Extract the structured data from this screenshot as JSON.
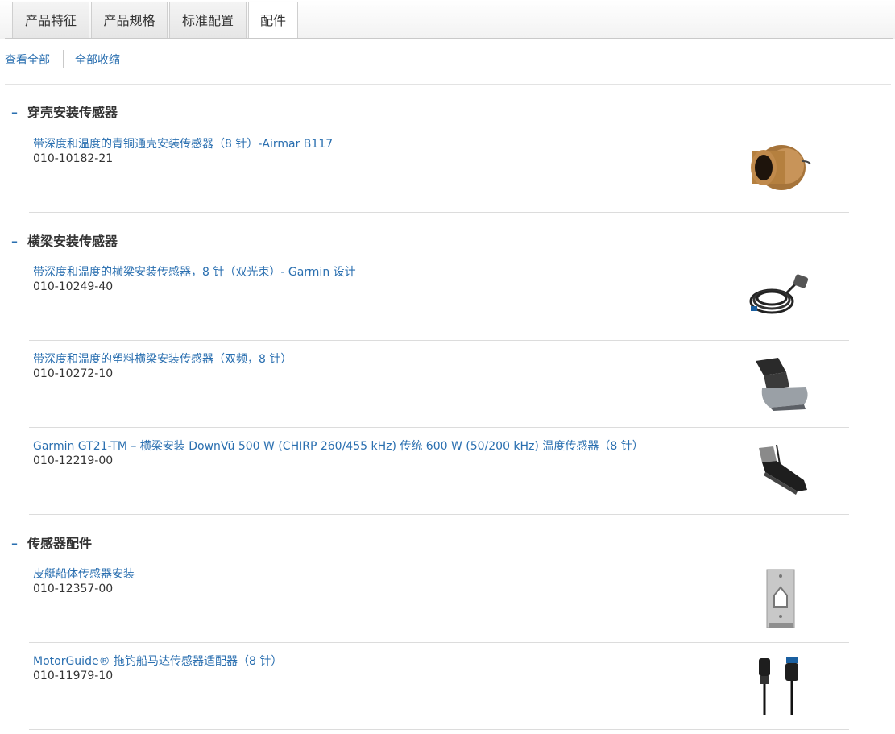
{
  "tabs": [
    "产品特征",
    "产品规格",
    "标准配置",
    "配件"
  ],
  "active_tab": "配件",
  "toggles": {
    "expand_all": "查看全部",
    "collapse_all": "全部收缩"
  },
  "sections": [
    {
      "title": "穿壳安装传感器",
      "items": [
        {
          "title": "带深度和温度的青铜通壳安装传感器（8 针）-Airmar B117",
          "sku": "010-10182-21",
          "image": "bronze-transducer-icon"
        }
      ]
    },
    {
      "title": "横梁安装传感器",
      "items": [
        {
          "title": "带深度和温度的横梁安装传感器，8 针（双光束）- Garmin 设计",
          "sku": "010-10249-40",
          "image": "coiled-cable-transducer-icon"
        },
        {
          "title": "带深度和温度的塑料横梁安装传感器（双频，8 针）",
          "sku": "010-10272-10",
          "image": "transom-transducer-icon"
        },
        {
          "title": "Garmin GT21-TM – 横梁安装 DownVü 500 W (CHIRP 260/455 kHz) 传统 600 W (50/200 kHz) 温度传感器（8 针）",
          "sku": "010-12219-00",
          "image": "downvu-transducer-icon"
        }
      ]
    },
    {
      "title": "传感器配件",
      "items": [
        {
          "title": "皮艇船体传感器安装",
          "sku": "010-12357-00",
          "image": "kayak-mount-plate-icon"
        },
        {
          "title": "MotorGuide® 拖钓船马达传感器适配器（8 针）",
          "sku": "010-11979-10",
          "image": "adapter-cable-icon"
        }
      ]
    }
  ],
  "colors": {
    "link": "#2a6fb0",
    "text": "#333333",
    "divider": "#dcdcdc"
  }
}
